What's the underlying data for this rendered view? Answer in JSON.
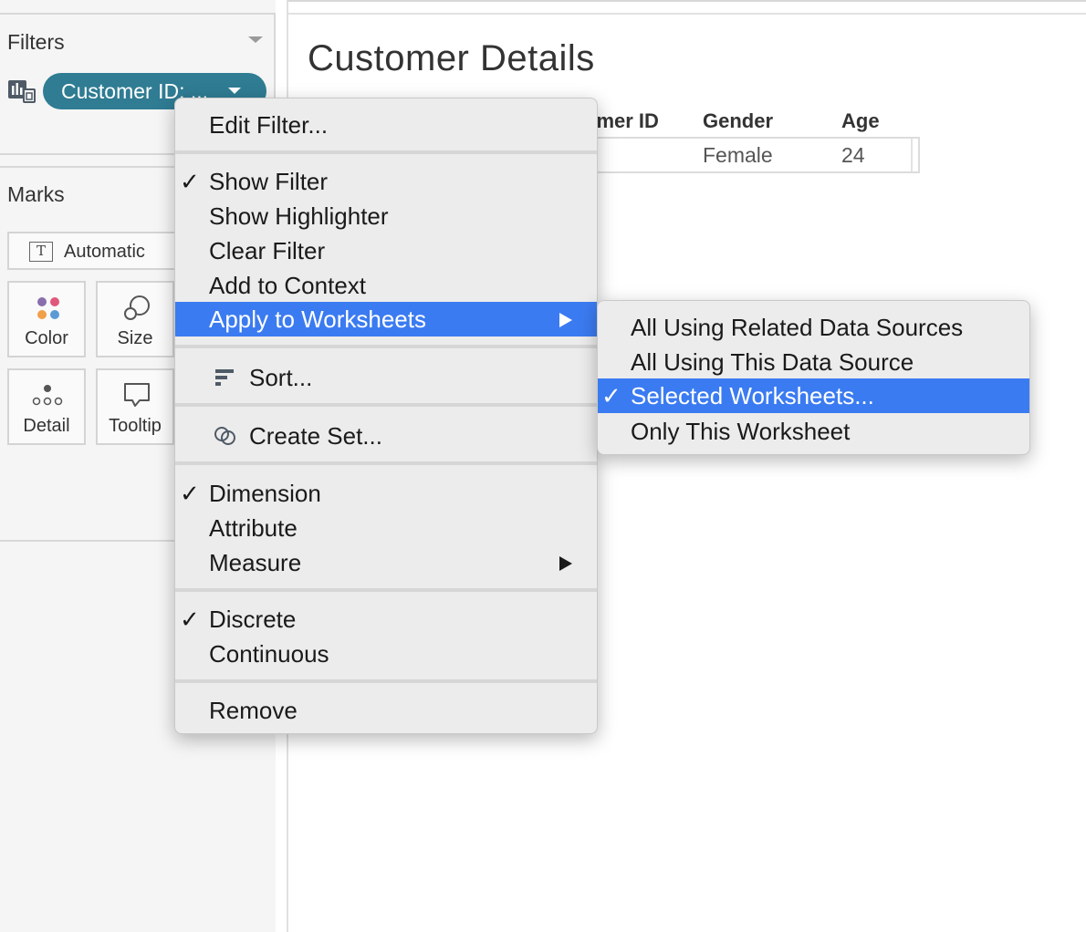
{
  "filters": {
    "title": "Filters",
    "pill_label": "Customer ID: ..."
  },
  "marks": {
    "title": "Marks",
    "mark_type": "Automatic",
    "buttons": [
      "Color",
      "Size",
      "Detail",
      "Tooltip"
    ]
  },
  "sheet": {
    "title": "Customer Details",
    "columns": [
      "omer ID",
      "Gender",
      "Age"
    ],
    "row": [
      "",
      "Female",
      "24"
    ]
  },
  "context_menu": {
    "edit_filter": "Edit Filter...",
    "show_filter": "Show Filter",
    "show_highlighter": "Show Highlighter",
    "clear_filter": "Clear Filter",
    "add_to_context": "Add to Context",
    "apply_to_worksheets": "Apply to Worksheets",
    "sort": "Sort...",
    "create_set": "Create Set...",
    "dimension": "Dimension",
    "attribute": "Attribute",
    "measure": "Measure",
    "discrete": "Discrete",
    "continuous": "Continuous",
    "remove": "Remove",
    "checkmark": "✓"
  },
  "submenu": {
    "items": [
      "All Using Related Data Sources",
      "All Using This Data Source",
      "Selected Worksheets...",
      "Only This Worksheet"
    ]
  },
  "colors": {
    "pill": "#2f7c93",
    "highlight": "#3b7bf1",
    "menu_bg": "#ececec"
  }
}
